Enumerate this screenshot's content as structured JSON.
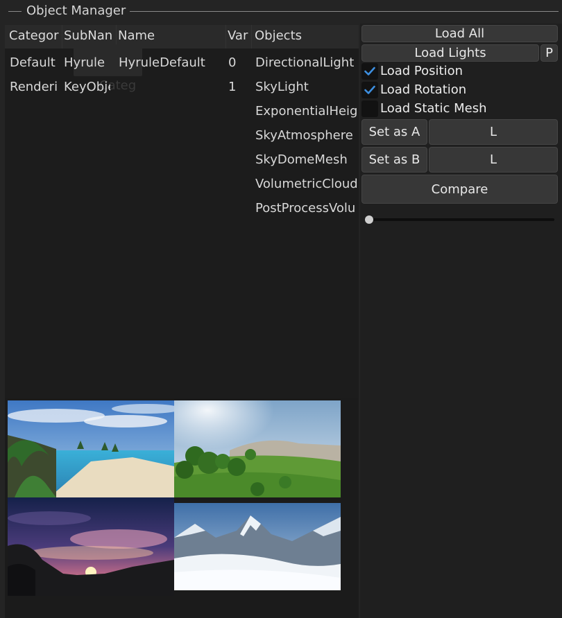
{
  "panel": {
    "title": "Object Manager"
  },
  "table": {
    "columns": [
      "Categor",
      "SubNan",
      "Name",
      "Var",
      "Objects"
    ],
    "rows": [
      {
        "category": "Default",
        "subname": "Hyrule",
        "name": "HyruleDefault",
        "variant": "0"
      },
      {
        "category": "Renderi",
        "subname": "KeyObje",
        "name": "",
        "variant": "1"
      }
    ],
    "ghost_label": "Categ",
    "objects": [
      "DirectionalLight",
      "SkyLight",
      "ExponentialHeigl",
      "SkyAtmosphere",
      "SkyDomeMesh",
      "VolumetricCloud",
      "PostProcessVolu"
    ]
  },
  "controls": {
    "load_all": "Load All",
    "load_lights": "Load Lights",
    "load_lights_p": "P",
    "load_position": {
      "label": "Load Position",
      "checked": true
    },
    "load_rotation": {
      "label": "Load Rotation",
      "checked": true
    },
    "load_static_mesh": {
      "label": "Load Static Mesh",
      "checked": false
    },
    "set_as_a": "Set as A",
    "set_a_value": "L",
    "set_as_b": "Set as B",
    "set_b_value": "L",
    "compare": "Compare",
    "slider_value": 0
  },
  "thumbnails": [
    "beach-scene",
    "grassland-scene",
    "sunset-scene",
    "snowy-mountain-scene"
  ]
}
